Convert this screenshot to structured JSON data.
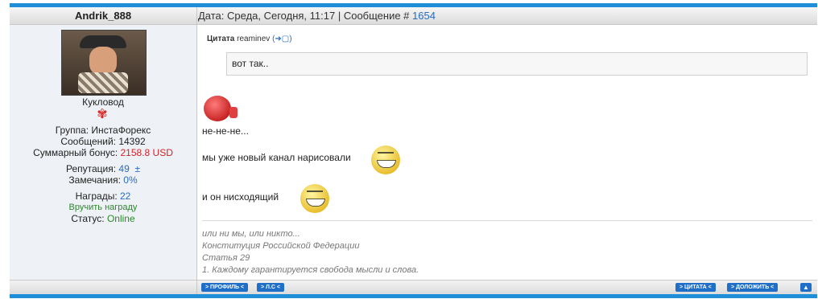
{
  "post": {
    "author": "Andrik_888",
    "date_label": "Дата: Среда, Сегодня, 11:17 | Сообщение # ",
    "message_number": "1654"
  },
  "profile": {
    "role": "Кукловод",
    "group": "Группа: ИнстаФорекс",
    "messages": "Сообщений: 14392",
    "bonus_label": "Суммарный бонус: ",
    "bonus_value": "2158.8 USD",
    "reputation_label": "Репутация: ",
    "reputation_value": "49",
    "reputation_plusminus": "±",
    "warnings_label": "Замечания: ",
    "warnings_value": "0%",
    "awards_label": "Награды: ",
    "awards_value": "22",
    "give_award": "Вручить награду",
    "status_label": "Статус: ",
    "status_value": "Online"
  },
  "quote": {
    "title": "Цитата",
    "author": "reaminev",
    "text": "вот так.."
  },
  "body": {
    "line1": "не-не-не...",
    "line2": "мы уже новый канал нарисовали",
    "line3": "и он нисходящий"
  },
  "signature": {
    "line1": "или ни мы, или никто...",
    "line2": "Конституция Российской Федерации",
    "line3": "Статья 29",
    "line4": "1. Каждому гарантируется свобода мысли и слова."
  },
  "footer": {
    "profile_btn": "ПРОФИЛЬ",
    "pm_btn": "Л.С",
    "quote_btn": "ЦИТАТА",
    "report_btn": "ДОЛОЖИТЬ",
    "up_icon": "up-arrow-icon"
  },
  "colors": {
    "accent": "#1f8ed8",
    "link": "#2a6cbf",
    "bonus": "#d2232a",
    "online": "#2a8a2a"
  }
}
